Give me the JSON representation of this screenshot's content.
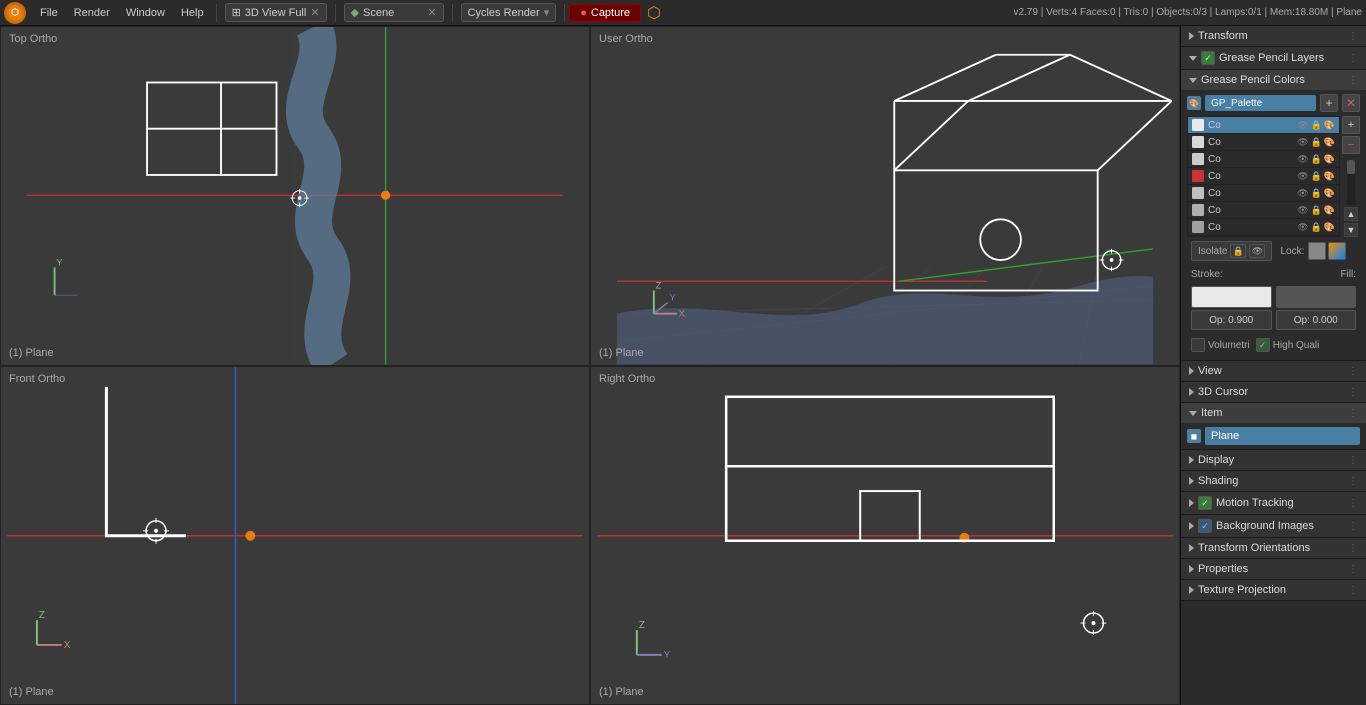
{
  "menu": {
    "logo": "B",
    "items": [
      "File",
      "Render",
      "Window",
      "Help"
    ],
    "workspace_icon": "⊞",
    "workspace": "3D View Full",
    "close_icon": "✕",
    "scene_icon": "◆",
    "scene": "Scene",
    "close2_icon": "✕",
    "engine": "Cycles Render",
    "capture_icon": "●",
    "capture_label": "Capture",
    "blender_icon": "⬡",
    "version_info": "v2.79 | Verts:4  Faces:0 | Tris:0 | Objects:0/3 | Lamps:0/1 | Mem:18.80M | Plane"
  },
  "viewports": {
    "top_left": {
      "label": "Top Ortho"
    },
    "top_right": {
      "label": "User Ortho"
    },
    "bottom_left": {
      "label": "Front Ortho"
    },
    "bottom_right": {
      "label": "Right Ortho"
    },
    "plane_label": "(1) Plane"
  },
  "right_panel": {
    "transform": {
      "label": "Transform",
      "collapsed": true
    },
    "gp_layers": {
      "label": "Grease Pencil Layers",
      "expanded": true,
      "checkbox": true
    },
    "gp_colors": {
      "label": "Grease Pencil Colors",
      "expanded": true,
      "palette_label": "GP_Palette",
      "colors": [
        {
          "id": "Co",
          "swatch": "#e8e8e8",
          "selected": true
        },
        {
          "id": "Co",
          "swatch": "#e0e0e0",
          "selected": false
        },
        {
          "id": "Co",
          "swatch": "#d8d8d8",
          "selected": false
        },
        {
          "id": "Co",
          "swatch": "#cc3333",
          "selected": false
        },
        {
          "id": "Co",
          "swatch": "#cccccc",
          "selected": false
        },
        {
          "id": "Co",
          "swatch": "#bbbbbb",
          "selected": false
        },
        {
          "id": "Co",
          "swatch": "#aaaaaa",
          "selected": false
        }
      ],
      "isolate_label": "Isolate",
      "lock_label": "Lock:",
      "stroke_label": "Stroke:",
      "fill_label": "Fill:",
      "op_stroke": "Op: 0.900",
      "op_fill": "Op: 0.000",
      "volumetric_label": "Volumetri",
      "high_quality_label": "High Quali"
    },
    "view": {
      "label": "View",
      "collapsed": true
    },
    "cursor_3d": {
      "label": "3D Cursor",
      "collapsed": true
    },
    "item": {
      "label": "Item",
      "expanded": true,
      "name": "Plane",
      "icon": "◼"
    },
    "display": {
      "label": "Display",
      "collapsed": true
    },
    "shading": {
      "label": "Shading",
      "collapsed": true
    },
    "motion_tracking": {
      "label": "Motion Tracking",
      "collapsed": true,
      "checkbox": true
    },
    "background_images": {
      "label": "Background Images",
      "collapsed": true,
      "checkbox": true
    },
    "transform_orientations": {
      "label": "Transform Orientations",
      "collapsed": true
    },
    "properties": {
      "label": "Properties",
      "collapsed": true
    },
    "texture_projection": {
      "label": "Texture Projection",
      "collapsed": true
    }
  }
}
